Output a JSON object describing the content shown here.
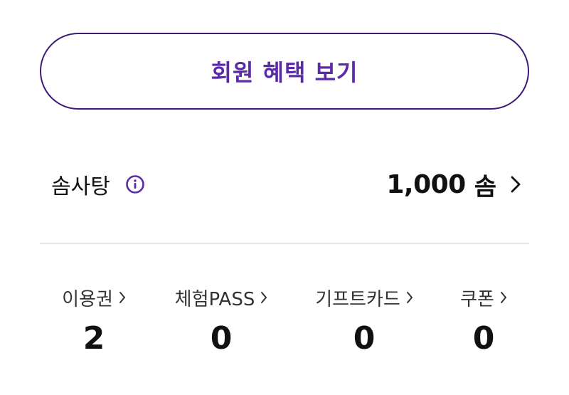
{
  "benefit_button": {
    "label": "회원 혜택 보기"
  },
  "candy": {
    "label": "솜사탕",
    "info_icon": "info-circle-icon",
    "amount": "1,000",
    "unit": "솜",
    "chevron_icon": "chevron-right-icon"
  },
  "stats": [
    {
      "label": "이용권",
      "value": "2"
    },
    {
      "label": "체험PASS",
      "value": "0"
    },
    {
      "label": "기프트카드",
      "value": "0"
    },
    {
      "label": "쿠폰",
      "value": "0"
    }
  ],
  "colors": {
    "accent": "#5a2aa8",
    "accent_border": "#3d1a78",
    "divider": "#e6e6e6",
    "text": "#111111"
  }
}
